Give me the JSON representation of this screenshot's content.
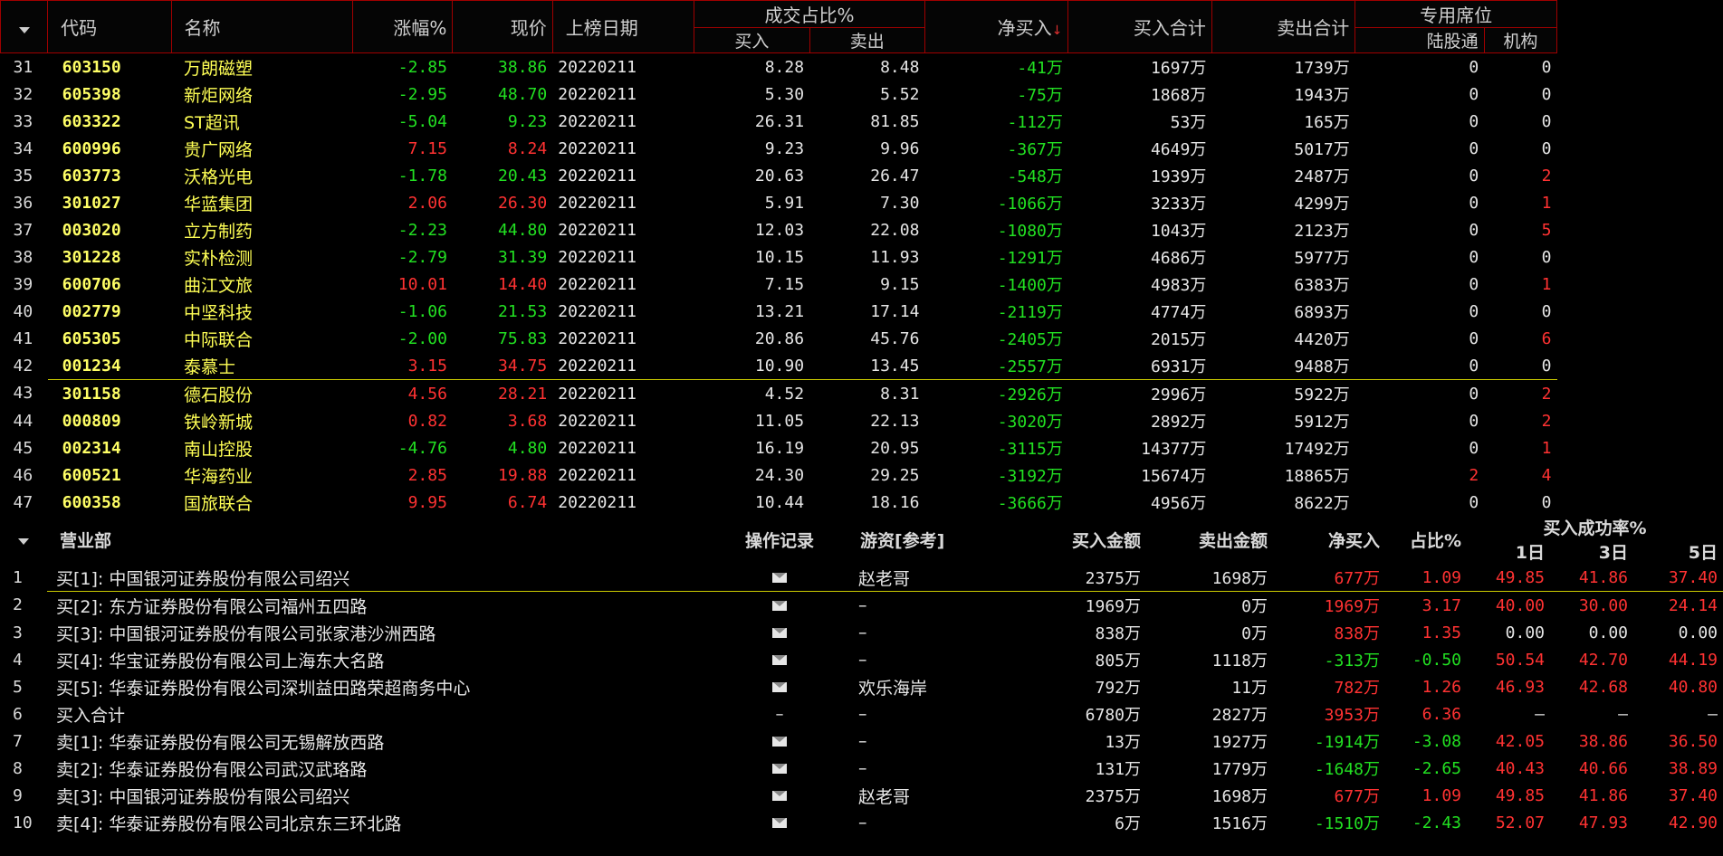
{
  "top": {
    "headers": {
      "code": "代码",
      "name": "名称",
      "change": "涨幅%",
      "price": "现价",
      "date": "上榜日期",
      "turnover_group": "成交占比%",
      "buy": "买入",
      "sell": "卖出",
      "net": "净买入",
      "sort_indicator": "↓",
      "buy_total": "买入合计",
      "sell_total": "卖出合计",
      "special_group": "专用席位",
      "hk": "陆股通",
      "inst": "机构"
    },
    "rows": [
      {
        "idx": "31",
        "code": "603150",
        "name": "万朗磁塑",
        "chg": "-2.85",
        "price": "38.86",
        "date": "20220211",
        "buy": "8.28",
        "sell": "8.48",
        "net": "-41万",
        "bt": "1697万",
        "st": "1739万",
        "hk": "0",
        "inst": "0",
        "cs": "neg",
        "ns": "neg",
        "hs": "w",
        "is": "w"
      },
      {
        "idx": "32",
        "code": "605398",
        "name": "新炬网络",
        "chg": "-2.95",
        "price": "48.70",
        "date": "20220211",
        "buy": "5.30",
        "sell": "5.52",
        "net": "-75万",
        "bt": "1868万",
        "st": "1943万",
        "hk": "0",
        "inst": "0",
        "cs": "neg",
        "ns": "neg",
        "hs": "w",
        "is": "w"
      },
      {
        "idx": "33",
        "code": "603322",
        "name": "ST超讯",
        "chg": "-5.04",
        "price": "9.23",
        "date": "20220211",
        "buy": "26.31",
        "sell": "81.85",
        "net": "-112万",
        "bt": "53万",
        "st": "165万",
        "hk": "0",
        "inst": "0",
        "cs": "neg",
        "ns": "neg",
        "hs": "w",
        "is": "w"
      },
      {
        "idx": "34",
        "code": "600996",
        "name": "贵广网络",
        "chg": "7.15",
        "price": "8.24",
        "date": "20220211",
        "buy": "9.23",
        "sell": "9.96",
        "net": "-367万",
        "bt": "4649万",
        "st": "5017万",
        "hk": "0",
        "inst": "0",
        "cs": "pos",
        "ns": "neg",
        "hs": "w",
        "is": "w"
      },
      {
        "idx": "35",
        "code": "603773",
        "name": "沃格光电",
        "chg": "-1.78",
        "price": "20.43",
        "date": "20220211",
        "buy": "20.63",
        "sell": "26.47",
        "net": "-548万",
        "bt": "1939万",
        "st": "2487万",
        "hk": "0",
        "inst": "2",
        "cs": "neg",
        "ns": "neg",
        "hs": "w",
        "is": "pos"
      },
      {
        "idx": "36",
        "code": "301027",
        "name": "华蓝集团",
        "chg": "2.06",
        "price": "26.30",
        "date": "20220211",
        "buy": "5.91",
        "sell": "7.30",
        "net": "-1066万",
        "bt": "3233万",
        "st": "4299万",
        "hk": "0",
        "inst": "1",
        "cs": "pos",
        "ns": "neg",
        "hs": "w",
        "is": "pos"
      },
      {
        "idx": "37",
        "code": "003020",
        "name": "立方制药",
        "chg": "-2.23",
        "price": "44.80",
        "date": "20220211",
        "buy": "12.03",
        "sell": "22.08",
        "net": "-1080万",
        "bt": "1043万",
        "st": "2123万",
        "hk": "0",
        "inst": "5",
        "cs": "neg",
        "ns": "neg",
        "hs": "w",
        "is": "pos"
      },
      {
        "idx": "38",
        "code": "301228",
        "name": "实朴检测",
        "chg": "-2.79",
        "price": "31.39",
        "date": "20220211",
        "buy": "10.15",
        "sell": "11.93",
        "net": "-1291万",
        "bt": "4686万",
        "st": "5977万",
        "hk": "0",
        "inst": "0",
        "cs": "neg",
        "ns": "neg",
        "hs": "w",
        "is": "w"
      },
      {
        "idx": "39",
        "code": "600706",
        "name": "曲江文旅",
        "chg": "10.01",
        "price": "14.40",
        "date": "20220211",
        "buy": "7.15",
        "sell": "9.15",
        "net": "-1400万",
        "bt": "4983万",
        "st": "6383万",
        "hk": "0",
        "inst": "1",
        "cs": "pos",
        "ns": "neg",
        "hs": "w",
        "is": "pos"
      },
      {
        "idx": "40",
        "code": "002779",
        "name": "中坚科技",
        "chg": "-1.06",
        "price": "21.53",
        "date": "20220211",
        "buy": "13.21",
        "sell": "17.14",
        "net": "-2119万",
        "bt": "4774万",
        "st": "6893万",
        "hk": "0",
        "inst": "0",
        "cs": "neg",
        "ns": "neg",
        "hs": "w",
        "is": "w"
      },
      {
        "idx": "41",
        "code": "605305",
        "name": "中际联合",
        "chg": "-2.00",
        "price": "75.83",
        "date": "20220211",
        "buy": "20.86",
        "sell": "45.76",
        "net": "-2405万",
        "bt": "2015万",
        "st": "4420万",
        "hk": "0",
        "inst": "6",
        "cs": "neg",
        "ns": "neg",
        "hs": "w",
        "is": "pos"
      },
      {
        "idx": "42",
        "code": "001234",
        "name": "泰慕士",
        "chg": "3.15",
        "price": "34.75",
        "date": "20220211",
        "buy": "10.90",
        "sell": "13.45",
        "net": "-2557万",
        "bt": "6931万",
        "st": "9488万",
        "hk": "0",
        "inst": "0",
        "cs": "pos",
        "ns": "neg",
        "hs": "w",
        "is": "w"
      },
      {
        "idx": "43",
        "code": "301158",
        "name": "德石股份",
        "chg": "4.56",
        "price": "28.21",
        "date": "20220211",
        "buy": "4.52",
        "sell": "8.31",
        "net": "-2926万",
        "bt": "2996万",
        "st": "5922万",
        "hk": "0",
        "inst": "2",
        "cs": "pos",
        "ns": "neg",
        "hs": "w",
        "is": "pos",
        "sep": true
      },
      {
        "idx": "44",
        "code": "000809",
        "name": "铁岭新城",
        "chg": "0.82",
        "price": "3.68",
        "date": "20220211",
        "buy": "11.05",
        "sell": "22.13",
        "net": "-3020万",
        "bt": "2892万",
        "st": "5912万",
        "hk": "0",
        "inst": "2",
        "cs": "pos",
        "ns": "neg",
        "hs": "w",
        "is": "pos"
      },
      {
        "idx": "45",
        "code": "002314",
        "name": "南山控股",
        "chg": "-4.76",
        "price": "4.80",
        "date": "20220211",
        "buy": "16.19",
        "sell": "20.95",
        "net": "-3115万",
        "bt": "14377万",
        "st": "17492万",
        "hk": "0",
        "inst": "1",
        "cs": "neg",
        "ns": "neg",
        "hs": "w",
        "is": "pos"
      },
      {
        "idx": "46",
        "code": "600521",
        "name": "华海药业",
        "chg": "2.85",
        "price": "19.88",
        "date": "20220211",
        "buy": "24.30",
        "sell": "29.25",
        "net": "-3192万",
        "bt": "15674万",
        "st": "18865万",
        "hk": "2",
        "inst": "4",
        "cs": "pos",
        "ns": "neg",
        "hs": "pos",
        "is": "pos"
      },
      {
        "idx": "47",
        "code": "600358",
        "name": "国旅联合",
        "chg": "9.95",
        "price": "6.74",
        "date": "20220211",
        "buy": "10.44",
        "sell": "18.16",
        "net": "-3666万",
        "bt": "4956万",
        "st": "8622万",
        "hk": "0",
        "inst": "0",
        "cs": "pos",
        "ns": "neg",
        "hs": "w",
        "is": "w"
      }
    ]
  },
  "bottom": {
    "headers": {
      "seat": "营业部",
      "record": "操作记录",
      "youzi": "游资[参考]",
      "buy_amt": "买入金额",
      "sell_amt": "卖出金额",
      "net": "净买入",
      "ratio": "占比%",
      "rate_group": "买入成功率%",
      "d1": "1日",
      "d3": "3日",
      "d5": "5日"
    },
    "rows": [
      {
        "idx": "1",
        "seat": "买[1]: 中国银河证券股份有限公司绍兴",
        "mail": true,
        "youzi": "赵老哥",
        "buy": "2375万",
        "sell": "1698万",
        "net": "677万",
        "ratio": "1.09",
        "d1": "49.85",
        "d3": "41.86",
        "d5": "37.40",
        "ns": "pos",
        "rs": "pos",
        "ds": "pos"
      },
      {
        "idx": "2",
        "seat": "买[2]: 东方证券股份有限公司福州五四路",
        "mail": true,
        "youzi": "–",
        "buy": "1969万",
        "sell": "0万",
        "net": "1969万",
        "ratio": "3.17",
        "d1": "40.00",
        "d3": "30.00",
        "d5": "24.14",
        "ns": "pos",
        "rs": "pos",
        "ds": "pos",
        "sep": true
      },
      {
        "idx": "3",
        "seat": "买[3]: 中国银河证券股份有限公司张家港沙洲西路",
        "mail": true,
        "youzi": "–",
        "buy": "838万",
        "sell": "0万",
        "net": "838万",
        "ratio": "1.35",
        "d1": "0.00",
        "d3": "0.00",
        "d5": "0.00",
        "ns": "pos",
        "rs": "pos",
        "ds": "w"
      },
      {
        "idx": "4",
        "seat": "买[4]: 华宝证券股份有限公司上海东大名路",
        "mail": true,
        "youzi": "–",
        "buy": "805万",
        "sell": "1118万",
        "net": "-313万",
        "ratio": "-0.50",
        "d1": "50.54",
        "d3": "42.70",
        "d5": "44.19",
        "ns": "neg",
        "rs": "neg",
        "ds": "pos"
      },
      {
        "idx": "5",
        "seat": "买[5]: 华泰证券股份有限公司深圳益田路荣超商务中心",
        "mail": true,
        "youzi": "欢乐海岸",
        "buy": "792万",
        "sell": "11万",
        "net": "782万",
        "ratio": "1.26",
        "d1": "46.93",
        "d3": "42.68",
        "d5": "40.80",
        "ns": "pos",
        "rs": "pos",
        "ds": "pos"
      },
      {
        "idx": "6",
        "seat": "买入合计",
        "mail": false,
        "rec": "–",
        "youzi": "–",
        "buy": "6780万",
        "sell": "2827万",
        "net": "3953万",
        "ratio": "6.36",
        "d1": "–",
        "d3": "–",
        "d5": "–",
        "ns": "pos",
        "rs": "pos",
        "ds": "w"
      },
      {
        "idx": "7",
        "seat": "卖[1]: 华泰证券股份有限公司无锡解放西路",
        "mail": true,
        "youzi": "–",
        "buy": "13万",
        "sell": "1927万",
        "net": "-1914万",
        "ratio": "-3.08",
        "d1": "42.05",
        "d3": "38.86",
        "d5": "36.50",
        "ns": "neg",
        "rs": "neg",
        "ds": "pos"
      },
      {
        "idx": "8",
        "seat": "卖[2]: 华泰证券股份有限公司武汉武珞路",
        "mail": true,
        "youzi": "–",
        "buy": "131万",
        "sell": "1779万",
        "net": "-1648万",
        "ratio": "-2.65",
        "d1": "40.43",
        "d3": "40.66",
        "d5": "38.89",
        "ns": "neg",
        "rs": "neg",
        "ds": "pos"
      },
      {
        "idx": "9",
        "seat": "卖[3]: 中国银河证券股份有限公司绍兴",
        "mail": true,
        "youzi": "赵老哥",
        "buy": "2375万",
        "sell": "1698万",
        "net": "677万",
        "ratio": "1.09",
        "d1": "49.85",
        "d3": "41.86",
        "d5": "37.40",
        "ns": "pos",
        "rs": "pos",
        "ds": "pos"
      },
      {
        "idx": "10",
        "seat": "卖[4]: 华泰证券股份有限公司北京东三环北路",
        "mail": true,
        "youzi": "–",
        "buy": "6万",
        "sell": "1516万",
        "net": "-1510万",
        "ratio": "-2.43",
        "d1": "52.07",
        "d3": "47.93",
        "d5": "42.90",
        "ns": "neg",
        "rs": "neg",
        "ds": "pos"
      }
    ]
  }
}
